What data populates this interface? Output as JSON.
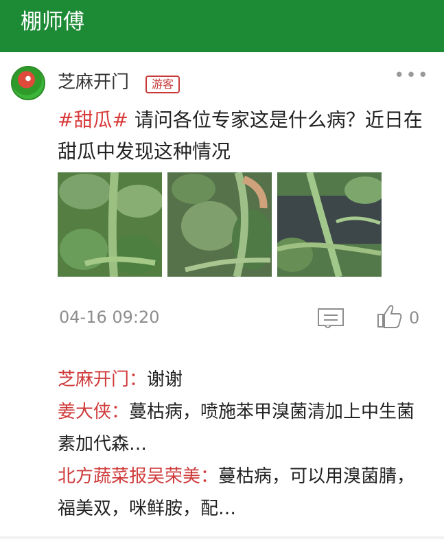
{
  "header": {
    "title": "棚师傅"
  },
  "post": {
    "author": "芝麻开门",
    "badge": "游客",
    "more": "•••",
    "topic": "#甜瓜#",
    "text": " 请问各位专家这是什么病？近日在甜瓜中发现这种情况",
    "timestamp": "04-16 09:20",
    "likes": "0",
    "photos": [
      {
        "name": "melon-vine-photo-1"
      },
      {
        "name": "melon-vine-photo-2"
      },
      {
        "name": "melon-vine-photo-3"
      }
    ]
  },
  "comments": [
    {
      "name": "芝麻开门：",
      "text": "谢谢"
    },
    {
      "name": "姜大侠：",
      "text": "蔓枯病，喷施苯甲溴菌清加上中生菌素加代森…"
    },
    {
      "name": "北方蔬菜报吴荣美：",
      "text": "蔓枯病，可以用溴菌腈，福美双，咪鲜胺，配…"
    }
  ],
  "colors": {
    "header": "#1d8a35",
    "accent_red": "#d83b3b",
    "muted_gray": "#8d8d8d"
  },
  "icons": {
    "comment": "comment-icon",
    "like": "thumbs-up-icon",
    "more": "more-dots-icon"
  }
}
